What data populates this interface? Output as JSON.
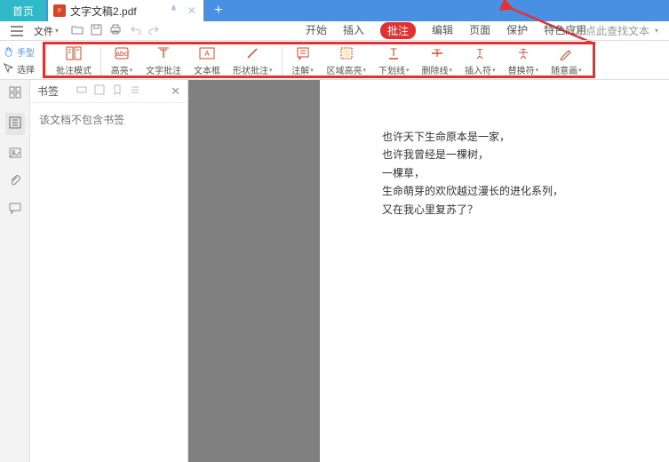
{
  "tabs": {
    "home": "首页",
    "doc": "文字文稿2.pdf",
    "pin_glyph": "📌",
    "close_glyph": "✕",
    "plus_glyph": "+"
  },
  "menubar": {
    "hamburger_name": "hamburger-icon",
    "file_label": "文件",
    "tabs": {
      "start": "开始",
      "insert": "插入",
      "annotate": "批注",
      "edit": "编辑",
      "page": "页面",
      "protect": "保护",
      "special": "特色应用"
    },
    "search_placeholder": "点此查找文本"
  },
  "left_tools": {
    "hand": "手型",
    "select": "选择"
  },
  "ribbon": {
    "mode": "批注模式",
    "highlight": "高亮",
    "text_annot": "文字批注",
    "textbox": "文本框",
    "shape_annot": "形状批注",
    "note": "注解",
    "area_hl": "区域高亮",
    "underline": "下划线",
    "strike": "删除线",
    "insertmark": "插入符",
    "replace": "替换符",
    "freehand": "随意画"
  },
  "sidebar": {
    "title": "书签",
    "empty": "该文档不包含书签"
  },
  "doc_lines": {
    "l1": "也许天下生命原本是一家，",
    "l2": "也许我曾经是一棵树，",
    "l3": "一棵草，",
    "l4": "生命萌芽的欢欣越过漫长的进化系列，",
    "l5": "又在我心里复苏了？"
  },
  "colors": {
    "accent": "#e33030",
    "tab_home": "#2fb9c9",
    "titlebar": "#4a90e2"
  }
}
